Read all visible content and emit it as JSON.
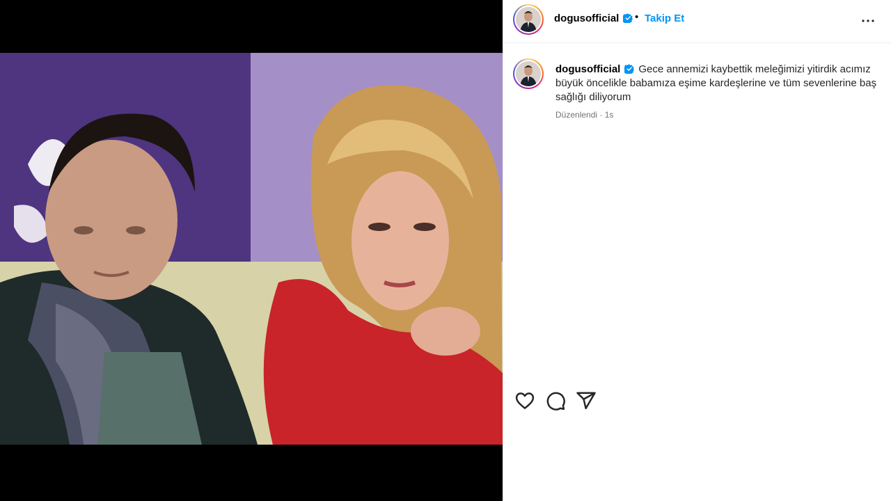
{
  "post": {
    "username": "dogusofficial",
    "follow_label": "Takip Et",
    "separator": "•",
    "caption": "Gece annemizi kaybettik meleğimizi yitirdik acımız büyük öncelikle babamıza eşime kardeşlerine ve tüm sevenlerine baş sağlığı diliyorum",
    "edited_label": "Düzenlendi",
    "meta_separator": "·",
    "time_ago": "1s"
  },
  "icons": {
    "verified": "verified-badge-icon",
    "more": "more-options-icon",
    "like": "heart-icon",
    "comment": "comment-icon",
    "share": "share-icon"
  },
  "colors": {
    "accent": "#0095f6",
    "verified": "#0095f6",
    "muted_text": "#737373",
    "divider": "#efefef"
  }
}
